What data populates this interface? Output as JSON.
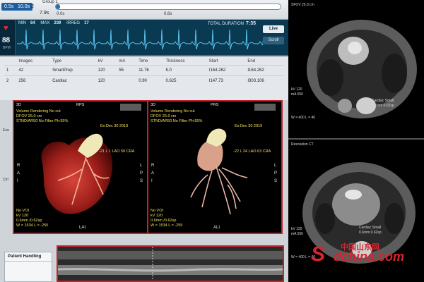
{
  "timeline": {
    "chips": [
      "0.5s",
      "10.0s",
      "2",
      "7.9s"
    ],
    "group_label": "Group 1",
    "tick_labels": [
      "0.0s",
      "0.8s"
    ],
    "progress_fraction": 0.02
  },
  "ecg": {
    "min_label": "MIN",
    "min_value": "64",
    "max_label": "MAX",
    "max_value": "239",
    "irreg_label": "IRREG",
    "irreg_value": "17",
    "total_label": "TOTAL DURATION",
    "total_value": "7:35",
    "bpm": "88",
    "bpm_unit": "BPM",
    "live_button": "Live",
    "scroll_button": "Scroll"
  },
  "series_table": {
    "columns": [
      "",
      "Images",
      "Type",
      "kV",
      "mA",
      "Time",
      "Thickness",
      "Start",
      "End"
    ],
    "rows": [
      [
        "1",
        "42",
        "SmartPrep",
        "120",
        "55",
        "11.76",
        "5.0",
        "I164.262",
        "I164.262"
      ],
      [
        "2",
        "256",
        "Cardiac",
        "120",
        "",
        "0.90",
        "0.625",
        "I147.73",
        "I303.106"
      ]
    ]
  },
  "vr_left": {
    "mode": "3D",
    "orient_top": "RPS",
    "title": "Volume Rendering No cut",
    "dfov": "DFOV 25.0 cm",
    "filter": "STND/AR50 No Filter Ph:55%",
    "exam_date": "Ex:Dec 30 2019",
    "angle": "-21 L 1 LAO 50 CRA",
    "voi": "No VOI",
    "kv": "kV 120",
    "thickness": "0.6mm /0.62sp",
    "window": "W = 1534 L = -255",
    "orient_left": "R\nA\nI",
    "orient_right": "L\nP\nS",
    "orient_bottom": "LAI"
  },
  "vr_right": {
    "mode": "3D",
    "orient_top": "PRS",
    "title": "Volume Rendering No cut",
    "dfov": "DFOV 25.0 cm",
    "filter": "STND/AR50 No Filter Ph:55%",
    "exam_date": "Ex:Dec 30 2019",
    "angle": "-22 L 24 LAO 63 CRA",
    "voi": "No VOI",
    "kv": "kV 120",
    "thickness": "0.6mm /0.62sp",
    "window": "W = 1534 L = -255",
    "orient_left": "R\nA\nI",
    "orient_right": "L\nP\nS",
    "orient_bottom": "ALI"
  },
  "side_tabs": [
    "Exa",
    "Ctrl"
  ],
  "patient_handling": {
    "title": "Patient Handling"
  },
  "ct_top": {
    "header": "SFOV 25.0 cm",
    "kv": "kV 120",
    "ma": "mA 550",
    "window": "W = 400 L = 40",
    "cardiac": "Cardiac Small",
    "slice": "0.6mm 0.62sp"
  },
  "ct_bottom": {
    "header": "Resolution CT",
    "kv": "kV 120",
    "ma": "mA 550",
    "window": "W = 400 L = 40",
    "cardiac": "Cardiac Small",
    "slice": "0.6mm 0.62sp"
  },
  "watermark": {
    "logo": "S",
    "main": "dchina.com",
    "cn": "中国山东网"
  }
}
